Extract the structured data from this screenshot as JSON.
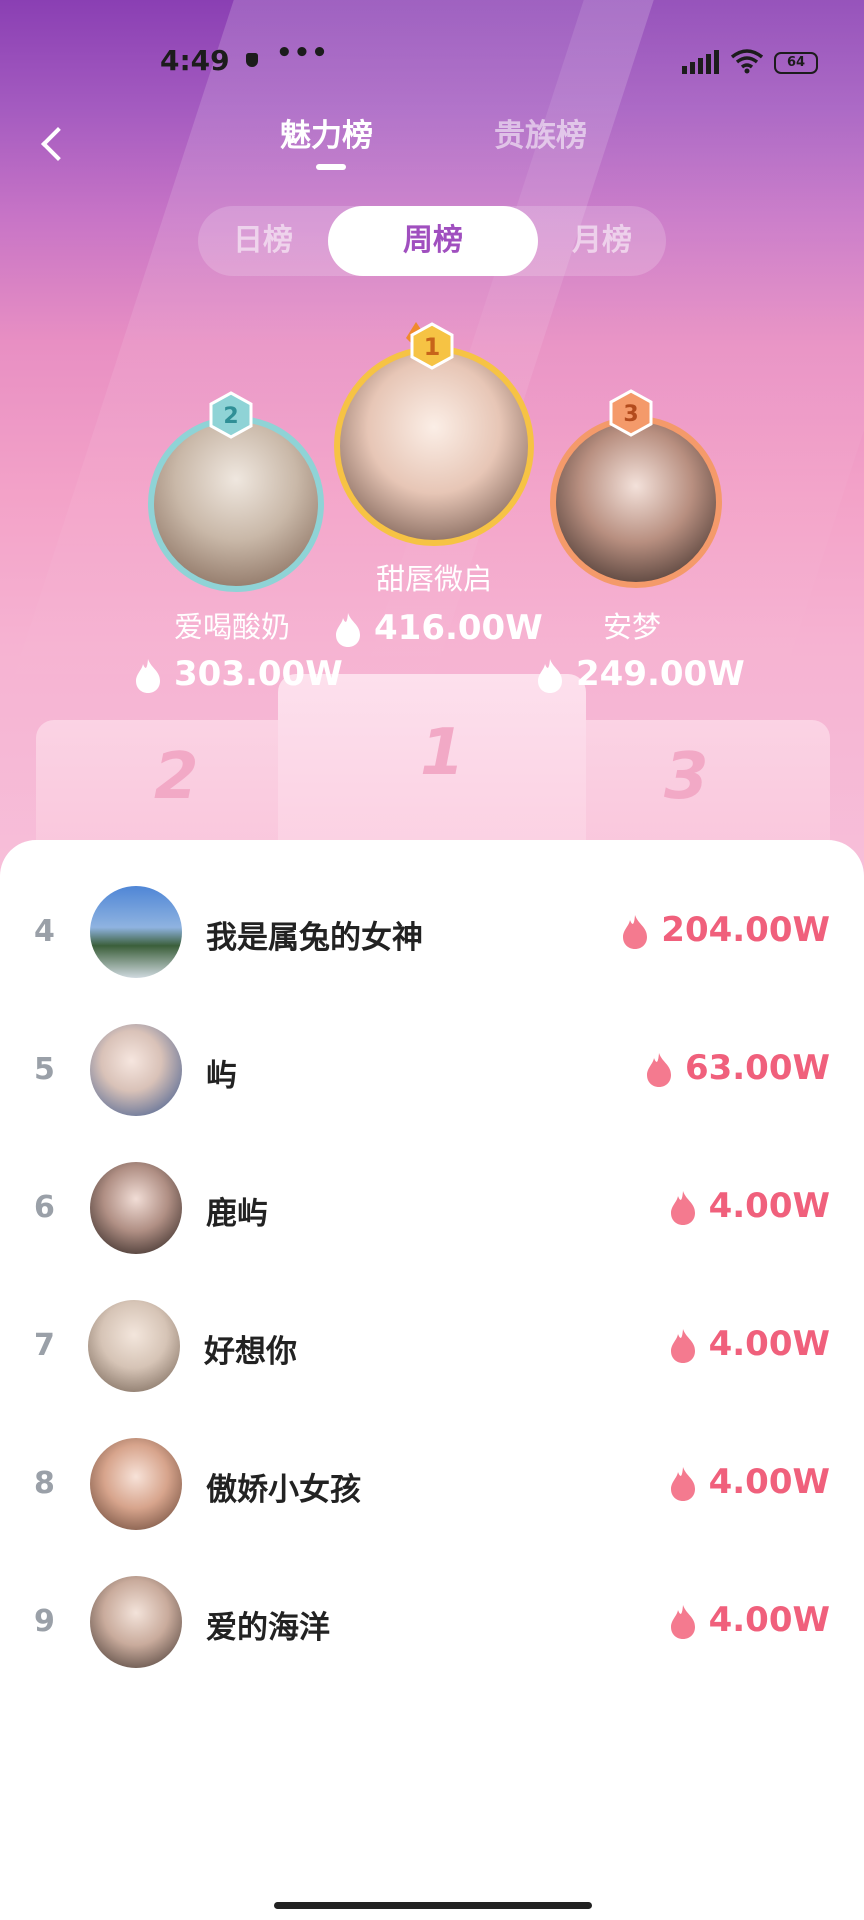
{
  "status_bar": {
    "time": "4:49",
    "dots": "•••",
    "battery": "64"
  },
  "header": {
    "tabs": [
      {
        "label": "魅力榜",
        "active": true
      },
      {
        "label": "贵族榜",
        "active": false
      }
    ]
  },
  "period_tabs": [
    {
      "label": "日榜"
    },
    {
      "label": "周榜",
      "active": true
    },
    {
      "label": "月榜"
    }
  ],
  "top_three": [
    {
      "rank": "1",
      "name": "甜唇微启",
      "score": "416.00W"
    },
    {
      "rank": "2",
      "name": "爱喝酸奶",
      "score": "303.00W"
    },
    {
      "rank": "3",
      "name": "安梦",
      "score": "249.00W"
    }
  ],
  "podium_labels": {
    "first": "1",
    "second": "2",
    "third": "3"
  },
  "ranking_list": [
    {
      "rank": "4",
      "name": "我是属兔的女神",
      "score": "204.00W"
    },
    {
      "rank": "5",
      "name": "屿",
      "score": "63.00W"
    },
    {
      "rank": "6",
      "name": "鹿屿",
      "score": "4.00W"
    },
    {
      "rank": "7",
      "name": "好想你",
      "score": "4.00W"
    },
    {
      "rank": "8",
      "name": "傲娇小女孩",
      "score": "4.00W"
    },
    {
      "rank": "9",
      "name": "爱的海洋",
      "score": "4.00W"
    }
  ],
  "colors": {
    "accent": "#a04fbf",
    "score": "#f0607c",
    "gold": "#f6c344",
    "silver": "#8fd3d6",
    "bronze": "#f49a6a"
  },
  "icons": {
    "back": "chevron-left-icon",
    "fire": "fire-icon",
    "crown": "crown-icon"
  }
}
